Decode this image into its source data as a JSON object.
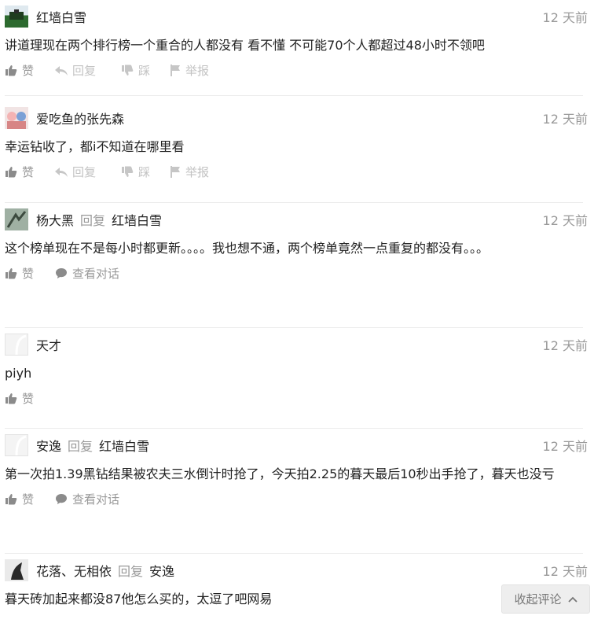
{
  "actions": {
    "like": "赞",
    "reply": "回复",
    "dislike": "踩",
    "report": "举报",
    "view_conversation": "查看对话"
  },
  "comments": [
    {
      "user": "红墙白雪",
      "reply_word": "",
      "reply_to": "",
      "time": "12 天前",
      "text": "讲道理现在两个排行榜一个重合的人都没有 看不懂 不可能70个人都超过48小时不领吧"
    },
    {
      "user": "爱吃鱼的张先森",
      "reply_word": "",
      "reply_to": "",
      "time": "12 天前",
      "text": "幸运钻收了，都i不知道在哪里看"
    },
    {
      "user": "杨大黑",
      "reply_word": "回复",
      "reply_to": "红墙白雪",
      "time": "12 天前",
      "text": "这个榜单现在不是每小时都更新。。。。我也想不通，两个榜单竟然一点重复的都没有。。。"
    },
    {
      "user": "天才",
      "reply_word": "",
      "reply_to": "",
      "time": "12 天前",
      "text": "piyh"
    },
    {
      "user": "安逸",
      "reply_word": "回复",
      "reply_to": "红墙白雪",
      "time": "12 天前",
      "text": "第一次拍1.39黑钻结果被农夫三水倒计时抢了，今天拍2.25的暮天最后10秒出手抢了，暮天也没亏"
    },
    {
      "user": "花落、无相依",
      "reply_word": "回复",
      "reply_to": "安逸",
      "time": "12 天前",
      "text": "暮天砖加起来都没87他怎么买的，太逗了吧网易"
    }
  ],
  "collapse_button": "收起评论"
}
